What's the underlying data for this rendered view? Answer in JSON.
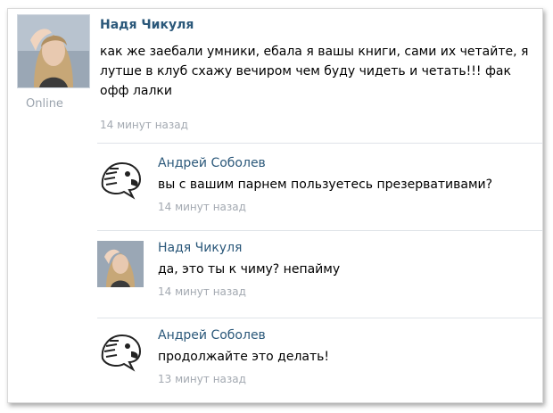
{
  "post": {
    "author": "Надя Чикуля",
    "status": "Online",
    "text": "как же заебали умники, ебала я вашы книги, сами их четайте, я лутше в клуб схажу вечиром чем буду чидеть и четать!!! фак офф лалки",
    "time": "14 минут назад"
  },
  "comments": [
    {
      "author": "Андрей Соболев",
      "text": "вы с вашим парнем пользуетесь презервативами?",
      "time": "14 минут назад",
      "avatar": "eagle-avatar"
    },
    {
      "author": "Надя Чикуля",
      "text": "да, это  ты к чиму? непайму",
      "time": "14 минут назад",
      "avatar": "girl-avatar"
    },
    {
      "author": "Андрей Соболев",
      "text": "продолжайте это делать!",
      "time": "13 минут назад",
      "avatar": "eagle-avatar"
    }
  ]
}
